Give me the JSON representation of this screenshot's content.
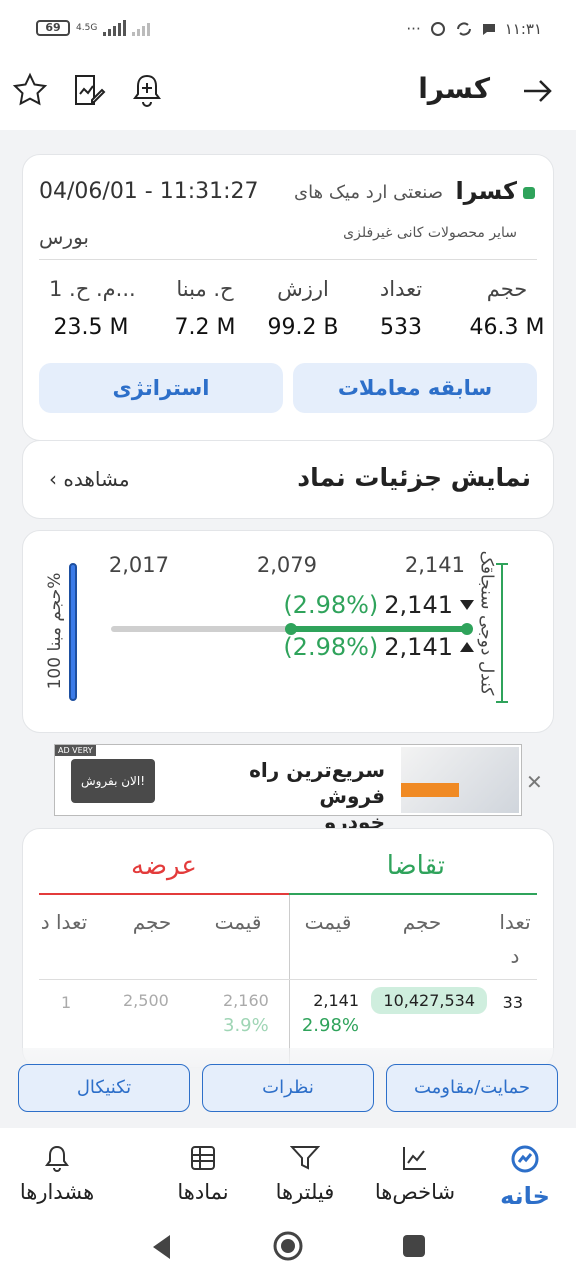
{
  "status_bar": {
    "time": "۱۱:۳۱",
    "battery": "69",
    "network": "4.5G",
    "dots": "···"
  },
  "header": {
    "title": "کسرا"
  },
  "symbol": {
    "name": "کسرا",
    "company": "صنعتی ارد میک های",
    "time": "04/06/01 - 11:31:27",
    "sector": "سایر محصولات کانی غیرفلزی",
    "market": "بورس",
    "stats": [
      {
        "label": "حجم",
        "value": "46.3 M"
      },
      {
        "label": "تعداد",
        "value": "533"
      },
      {
        "label": "ارزش",
        "value": "99.2 B"
      },
      {
        "label": "ح. مبنا",
        "value": "7.2 M"
      },
      {
        "label": "م. ح. 1...",
        "value": "23.5 M"
      }
    ],
    "history_button": "سابقه معاملات",
    "strategy_button": "استراتژی"
  },
  "details": {
    "title": "نمایش جزئیات نماد",
    "view": "مشاهده"
  },
  "candle": {
    "side_label": "کندل دوجی سنجاقک",
    "scale": [
      "2,141",
      "2,079",
      "2,017"
    ],
    "last_price": "2,141",
    "last_pct": "(2.98%)",
    "close_price": "2,141",
    "close_pct": "(2.98%)",
    "base_volume_label": "حجم مبنا 100%",
    "range_fraction": 1.0
  },
  "ad": {
    "tag": "AD VERY",
    "text_line1": "سریع‌ترین راه فروش",
    "text_line2": "خودرو",
    "cta": "الان بفروش!",
    "close": "✕"
  },
  "orders": {
    "buy_title": "تقاضا",
    "sell_title": "عرضه",
    "buy_cols": [
      "تعدا د",
      "حجم",
      "قیمت"
    ],
    "sell_cols": [
      "قیمت",
      "حجم",
      "تعدا د"
    ],
    "rows": [
      {
        "buy_count": "33",
        "buy_volume": "10,427,534",
        "buy_price": "2,141",
        "buy_pct": "2.98%",
        "sell_price": "2,160",
        "sell_pct": "3.9%",
        "sell_volume": "2,500",
        "sell_count": "1"
      }
    ]
  },
  "chips": [
    "حمایت/مقاومت",
    "نظرات",
    "تکنیکال"
  ],
  "bottom_nav": [
    {
      "label": "خانه",
      "icon": "home-icon",
      "active": true
    },
    {
      "label": "شاخص‌ها",
      "icon": "chart-icon"
    },
    {
      "label": "فیلترها",
      "icon": "filter-icon"
    },
    {
      "label": "نمادها",
      "icon": "grid-icon"
    },
    {
      "label": "هشدارها",
      "icon": "bell-icon"
    }
  ],
  "colors": {
    "accent": "#2d6fc9",
    "positive": "#2fa35b",
    "negative": "#e33b3b"
  }
}
